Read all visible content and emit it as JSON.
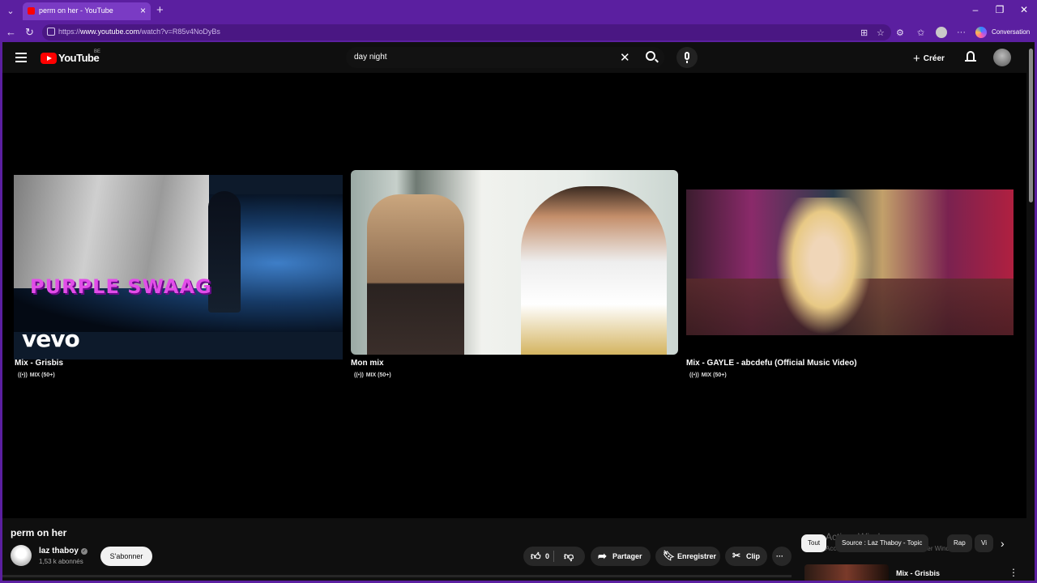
{
  "browser": {
    "tab_title": "perm on her - YouTube",
    "tab_close": "×",
    "new_tab": "+",
    "url_prefix": "https://",
    "url_host": "www.youtube.com",
    "url_path": "/watch?v=R85v4NoDyBs",
    "copilot_label": "Conversation",
    "window_controls": [
      "–",
      "❐",
      "✕"
    ]
  },
  "youtube": {
    "logo_text": "YouTube",
    "country_code": "BE",
    "search_query": "day night",
    "create_label": "Créer"
  },
  "end_screen": [
    {
      "title": "Mix - Grisbis",
      "badge": "MIX (50+)",
      "thumb_text": "PURPLE SWAAG",
      "thumb_brand": "vevo"
    },
    {
      "title": "Mon mix",
      "badge": "MIX (50+)"
    },
    {
      "title": "Mix - GAYLE - abcdefu (Official Music Video)",
      "badge": "MIX (50+)"
    }
  ],
  "video": {
    "title": "perm on her",
    "channel_name": "laz thaboy",
    "subscribers": "1,53 k abonnés",
    "subscribe_label": "S'abonner",
    "likes": "0",
    "share_label": "Partager",
    "save_label": "Enregistrer",
    "clip_label": "Clip",
    "more_label": "···"
  },
  "chips": [
    "Tout",
    "Source : Laz Thaboy - Topic",
    "Rap",
    "Vi"
  ],
  "up_next": {
    "title": "Mix - Grisbis"
  },
  "overlay": {
    "activate_title": "Activer Windows",
    "activate_sub": "Accédez aux paramètres pour activer Windows."
  },
  "colors": {
    "browser_accent": "#5b1fa0",
    "youtube_red": "#ff0000",
    "background": "#0f0f0f"
  }
}
